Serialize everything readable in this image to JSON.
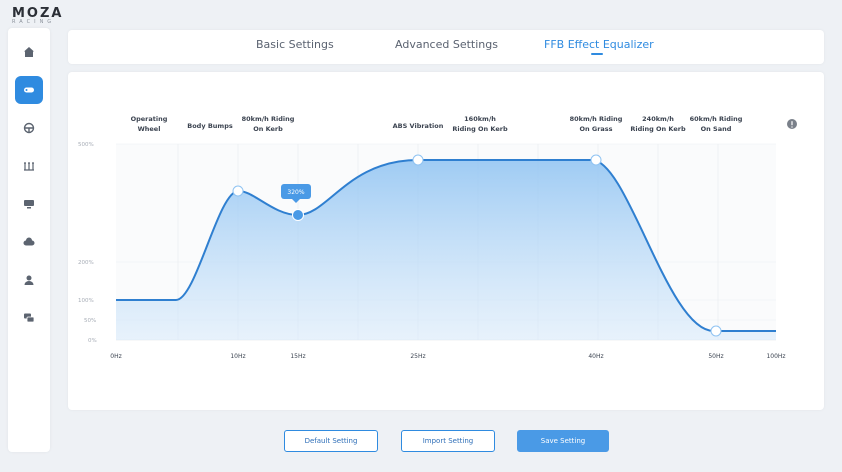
{
  "brand": {
    "name": "MOZA",
    "sub": "RACING"
  },
  "sidebar": {
    "items": [
      {
        "icon": "home-icon",
        "active": false
      },
      {
        "icon": "steering-base-icon",
        "active": true
      },
      {
        "icon": "steering-wheel-icon",
        "active": false
      },
      {
        "icon": "pedals-icon",
        "active": false
      },
      {
        "icon": "dashboard-icon",
        "active": false
      },
      {
        "icon": "cloud-icon",
        "active": false
      },
      {
        "icon": "user-icon",
        "active": false
      },
      {
        "icon": "chat-icon",
        "active": false
      }
    ]
  },
  "tabs": [
    {
      "label": "Basic Settings",
      "active": false
    },
    {
      "label": "Advanced Settings",
      "active": false
    },
    {
      "label": "FFB Effect Equalizer",
      "active": true
    }
  ],
  "equalizer": {
    "effects": [
      {
        "line1": "Operating",
        "line2": "Wheel"
      },
      {
        "line1": "Body Bumps",
        "line2": ""
      },
      {
        "line1": "80km/h Riding",
        "line2": "On Kerb"
      },
      {
        "line1": "ABS Vibration",
        "line2": ""
      },
      {
        "line1": "160km/h",
        "line2": "Riding On Kerb"
      },
      {
        "line1": "80km/h Riding",
        "line2": "On Grass"
      },
      {
        "line1": "240km/h",
        "line2": "Riding On Kerb"
      },
      {
        "line1": "60km/h Riding",
        "line2": "On Sand"
      }
    ],
    "y_ticks": [
      "500%",
      "200%",
      "100%",
      "50%",
      "0%"
    ],
    "x_ticks": [
      "0Hz",
      "10Hz",
      "15Hz",
      "25Hz",
      "40Hz",
      "50Hz",
      "100Hz"
    ],
    "tooltip": "320%",
    "info_icon": "info-icon",
    "accent": "#2f8be0"
  },
  "buttons": {
    "default": "Default Setting",
    "import": "Import Setting",
    "save": "Save Setting"
  }
}
